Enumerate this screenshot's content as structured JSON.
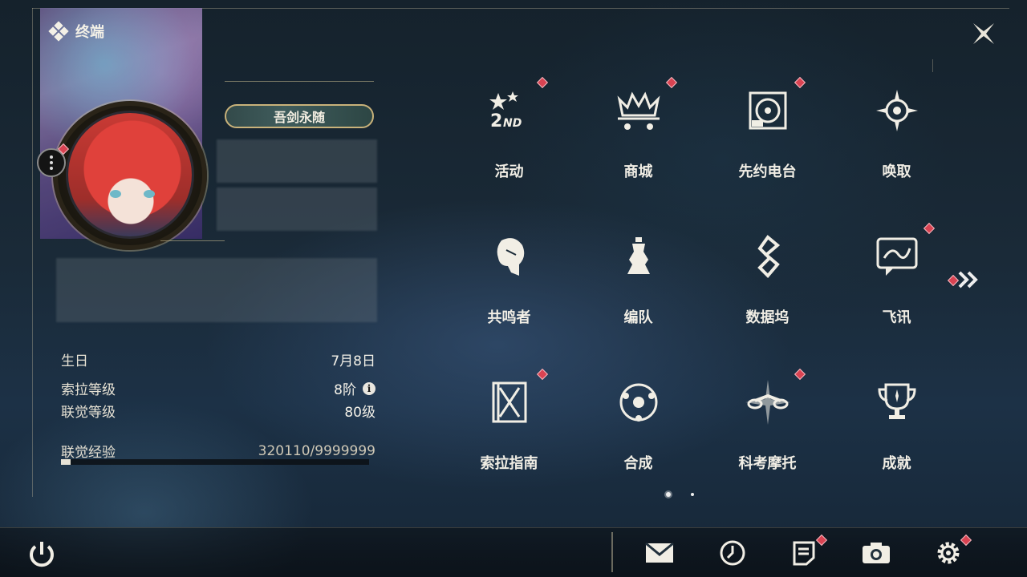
{
  "header": {
    "title": "终端",
    "close_icon": "close-x-icon"
  },
  "profile": {
    "title_plate": "吾剑永随",
    "stats": {
      "birthday": {
        "label": "生日",
        "value": "7月8日"
      },
      "sola_level": {
        "label": "索拉等级",
        "value": "8阶"
      },
      "union_level": {
        "label": "联觉等级",
        "value": "80级"
      },
      "union_exp": {
        "label": "联觉经验",
        "value": "320110/9999999",
        "progress": 0.032
      }
    }
  },
  "menu": [
    {
      "label": "活动",
      "icon": "event-2nd-icon",
      "badge": true
    },
    {
      "label": "商城",
      "icon": "shop-crown-cart-icon",
      "badge": true
    },
    {
      "label": "先约电台",
      "icon": "radio-record-icon",
      "badge": true
    },
    {
      "label": "唤取",
      "icon": "convene-compass-icon",
      "badge": false
    },
    {
      "label": "共鸣者",
      "icon": "resonator-head-icon",
      "badge": false
    },
    {
      "label": "编队",
      "icon": "team-chess-icon",
      "badge": false
    },
    {
      "label": "数据坞",
      "icon": "data-bank-icon",
      "badge": false
    },
    {
      "label": "飞讯",
      "icon": "message-chat-icon",
      "badge": true
    },
    {
      "label": "索拉指南",
      "icon": "guide-book-icon",
      "badge": true
    },
    {
      "label": "合成",
      "icon": "synthesis-orbit-icon",
      "badge": false
    },
    {
      "label": "科考摩托",
      "icon": "motorbike-icon",
      "badge": true
    },
    {
      "label": "成就",
      "icon": "achievement-trophy-icon",
      "badge": false
    }
  ],
  "toolbar": [
    {
      "name": "mail",
      "icon": "mail-icon",
      "badge": false
    },
    {
      "name": "clock",
      "icon": "clock-icon",
      "badge": false
    },
    {
      "name": "notice",
      "icon": "notice-icon",
      "badge": true
    },
    {
      "name": "camera",
      "icon": "camera-icon",
      "badge": false
    },
    {
      "name": "settings",
      "icon": "gear-icon",
      "badge": true
    }
  ],
  "colors": {
    "badge": "#d94352",
    "text": "#f1eee5",
    "gold": "#c9b27a"
  }
}
